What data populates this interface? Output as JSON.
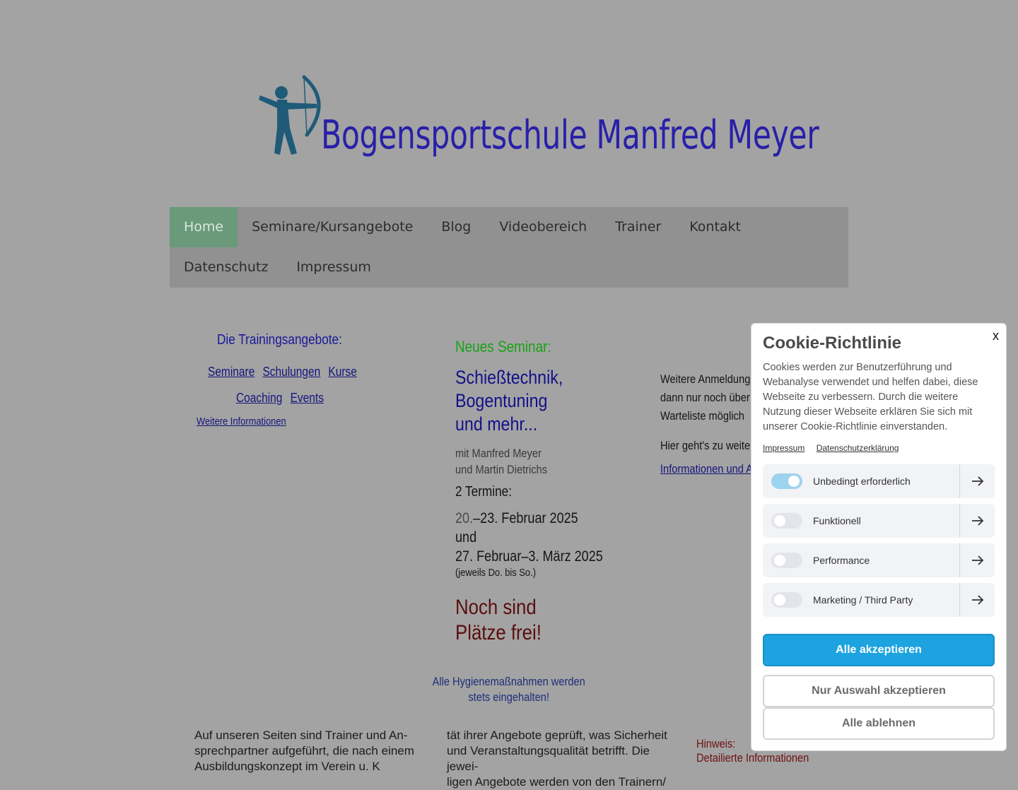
{
  "header": {
    "site_title": "Bogensportschule Manfred Meyer",
    "logo_icon": "archer-icon"
  },
  "nav": {
    "items": [
      {
        "label": "Home",
        "active": true
      },
      {
        "label": "Seminare/Kursangebote"
      },
      {
        "label": "Blog"
      },
      {
        "label": "Videobereich"
      },
      {
        "label": "Trainer"
      },
      {
        "label": "Kontakt"
      },
      {
        "label": "Datenschutz"
      },
      {
        "label": "Impressum"
      }
    ]
  },
  "left": {
    "title": "Die Trainingsangebote:",
    "links_row1": [
      "Seminare",
      "Schulungen",
      "Kurse"
    ],
    "links_row2": [
      "Coaching",
      "Events"
    ],
    "more": "Weitere Informationen"
  },
  "middle": {
    "new_label": "Neues Seminar:",
    "title_lines": [
      "Schießtechnik,",
      "Bogentuning",
      "und mehr..."
    ],
    "with_lines": [
      "mit Manfred Meyer",
      "und Martin Dietrichs"
    ],
    "termine": "2 Termine:",
    "date1_prefix": "20.",
    "date1_rest": "–23. Februar 2025",
    "and": "und",
    "date2": "27. Februar–3. März 2025",
    "note": "(jeweils Do. bis So.)",
    "free_lines": [
      "Noch sind",
      "Plätze frei!"
    ],
    "hygiene_lines": [
      "Alle Hygienemaßnahmen werden",
      "stets eingehalten!"
    ]
  },
  "right": {
    "text_lines": [
      "Weitere Anmeldungen",
      "dann nur noch über",
      "Warteliste möglich"
    ],
    "more": "Hier geht's zu weite",
    "link": "Informationen und A"
  },
  "bottom": {
    "left_lines": [
      "Auf unseren Seiten sind Trainer und An-",
      "sprechpartner aufgeführt, die nach einem",
      "Ausbildungskonzept im Verein u. K"
    ],
    "mid_lines": [
      "tät ihrer Angebote geprüft, was Sicherheit",
      "und Veranstaltungsqualität betrifft. Die jewei-",
      "ligen Angebote werden von den Trainern/"
    ],
    "right_heading": "Hinweis:",
    "right_link": "Detailierte Informationen"
  },
  "cookie": {
    "close": "x",
    "title": "Cookie-Richtlinie",
    "text": "Cookies werden zur Benutzerführung und Webanalyse verwendet und helfen dabei, diese Webseite zu verbessern. Durch die weitere Nutzung dieser Webseite erklären Sie sich mit unserer Cookie-Richtlinie einverstanden.",
    "links": [
      "Impressum",
      "Datenschutzerklärung"
    ],
    "categories": [
      {
        "label": "Unbedingt erforderlich",
        "enabled": true
      },
      {
        "label": "Funktionell",
        "enabled": false
      },
      {
        "label": "Performance",
        "enabled": false
      },
      {
        "label": "Marketing / Third Party",
        "enabled": false
      }
    ],
    "accept_all": "Alle akzeptieren",
    "accept_selection": "Nur Auswahl akzeptieren",
    "reject_all": "Alle ablehnen"
  },
  "colors": {
    "overlay_bg": "#a3a3a3",
    "brand_blue": "#2820a8",
    "accept_button": "#1ca3e0",
    "nav_active": "#6a9a7a"
  }
}
